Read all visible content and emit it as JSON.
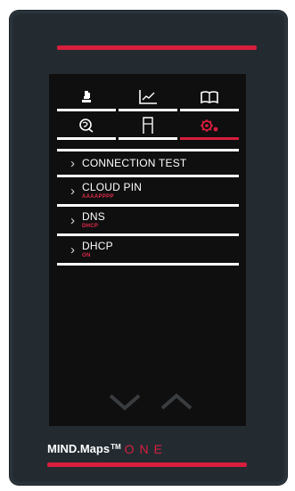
{
  "menu": {
    "items": [
      {
        "label": "CONNECTION TEST",
        "sub": ""
      },
      {
        "label": "CLOUD PIN",
        "sub": "AAAAPPPP"
      },
      {
        "label": "DNS",
        "sub": "DHCP"
      },
      {
        "label": "DHCP",
        "sub": "ON"
      }
    ]
  },
  "brand": {
    "name": "MIND.Maps",
    "trademark": "TM",
    "edition": "ONE"
  },
  "tabs": [
    {
      "icon": "microscope-icon",
      "active": false
    },
    {
      "icon": "chart-icon",
      "active": false
    },
    {
      "icon": "book-icon",
      "active": false
    },
    {
      "icon": "globe-icon",
      "active": false
    },
    {
      "icon": "door-icon",
      "active": false
    },
    {
      "icon": "gear-icon",
      "active": true
    }
  ],
  "colors": {
    "accent": "#d81e3c",
    "screen": "#0f0f10",
    "device": "#262f35"
  }
}
